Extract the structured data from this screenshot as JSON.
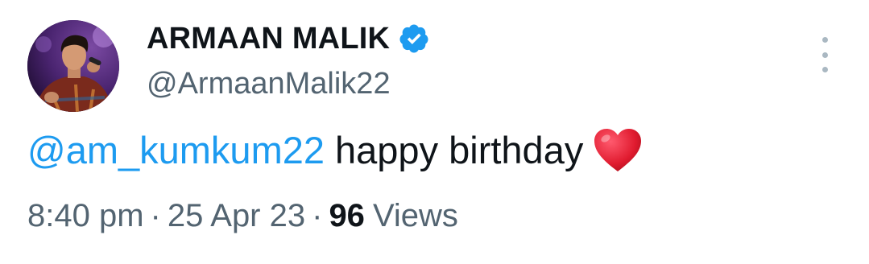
{
  "tweet": {
    "author": {
      "display_name": "ARMAAN MALIK",
      "handle": "@ArmaanMalik22",
      "verified": true,
      "avatar_icon": "profile-photo-avatar"
    },
    "more_icon": "vertical-ellipsis-icon",
    "text": {
      "mention": "@am_kumkum22",
      "body": "happy birthday",
      "emoji": "red-heart-emoji"
    },
    "meta": {
      "time": "8:40 pm",
      "separator": "·",
      "date": "25 Apr 23",
      "views_count": "96",
      "views_label": "Views"
    }
  },
  "colors": {
    "link": "#1d9bf0",
    "verified_badge": "#1d9bf0",
    "primary_text": "#0f1419",
    "secondary_text": "#536471",
    "heart": "#e0245e"
  }
}
